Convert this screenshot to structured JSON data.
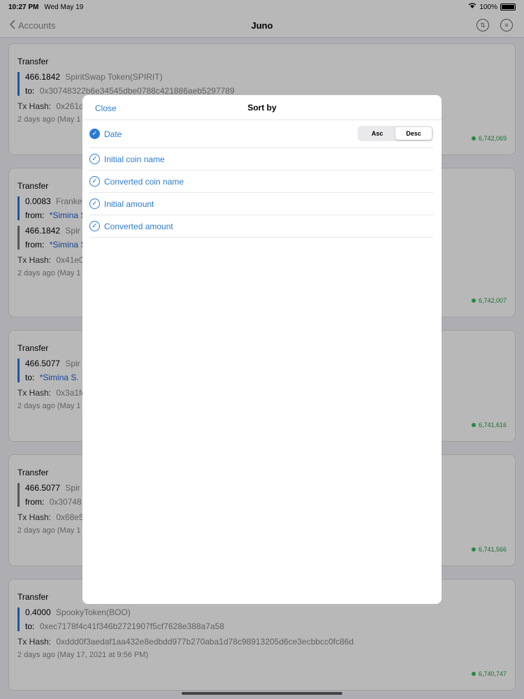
{
  "status": {
    "time": "10:27 PM",
    "date": "Wed May 19",
    "battery": "100%"
  },
  "nav": {
    "back_label": "Accounts",
    "title": "Juno"
  },
  "cards": [
    {
      "type": "Transfer",
      "transfers": [
        {
          "amount": "466.1842",
          "token": "SpiritSwap Token(SPIRIT)",
          "dir": "to:",
          "addr": "0x30748322b6e34545dbe0788c421886aeb5297789"
        }
      ],
      "tx_label": "Tx Hash:",
      "tx_hash": "0x261d",
      "date": "2 days ago (May 1",
      "block": "6,742,069"
    },
    {
      "type": "Transfer",
      "transfers": [
        {
          "amount": "0.0083",
          "token": "Franke",
          "dir": "from:",
          "user": "*Simina S"
        },
        {
          "amount": "466.1842",
          "token": "Spir",
          "dir": "from:",
          "user": "*Simina S"
        }
      ],
      "tx_label": "Tx Hash:",
      "tx_hash": "0x41e0",
      "date": "2 days ago (May 1",
      "block": "6,742,007"
    },
    {
      "type": "Transfer",
      "transfers": [
        {
          "amount": "466.5077",
          "token": "Spir",
          "dir": "to:",
          "user": "*Simina S."
        }
      ],
      "tx_label": "Tx Hash:",
      "tx_hash": "0x3a1fc",
      "date": "2 days ago (May 1",
      "block": "6,741,616"
    },
    {
      "type": "Transfer",
      "transfers": [
        {
          "amount": "466.5077",
          "token": "Spir",
          "dir": "from:",
          "addr": "0x30748"
        }
      ],
      "tx_label": "Tx Hash:",
      "tx_hash": "0x68e5",
      "date": "2 days ago (May 1",
      "block": "6,741,566"
    },
    {
      "type": "Transfer",
      "transfers": [
        {
          "amount": "0.4000",
          "token": "SpookyToken(BOO)",
          "dir": "to:",
          "addr": "0xec7178f4c41f346b2721907f5cf7628e388a7a58"
        }
      ],
      "tx_label": "Tx Hash:",
      "tx_hash": "0xddd0f3aedaf1aa432e8edbdd977b270aba1d78c98913205d6ce3ecbbcc0fc86d",
      "date": "2 days ago (May 17, 2021 at 9:56 PM)",
      "block": "6,740,747"
    }
  ],
  "modal": {
    "close_label": "Close",
    "title": "Sort by",
    "options": [
      {
        "label": "Date",
        "selected": true
      },
      {
        "label": "Initial coin name",
        "selected": false
      },
      {
        "label": "Converted coin name",
        "selected": false
      },
      {
        "label": "Initial amount",
        "selected": false
      },
      {
        "label": "Converted amount",
        "selected": false
      }
    ],
    "order": {
      "asc": "Asc",
      "desc": "Desc",
      "active": "desc"
    }
  },
  "colors": {
    "accent": "#2a7bd6",
    "block_green": "#2ec35a",
    "overlay": "rgba(0,0,0,0.28)"
  }
}
